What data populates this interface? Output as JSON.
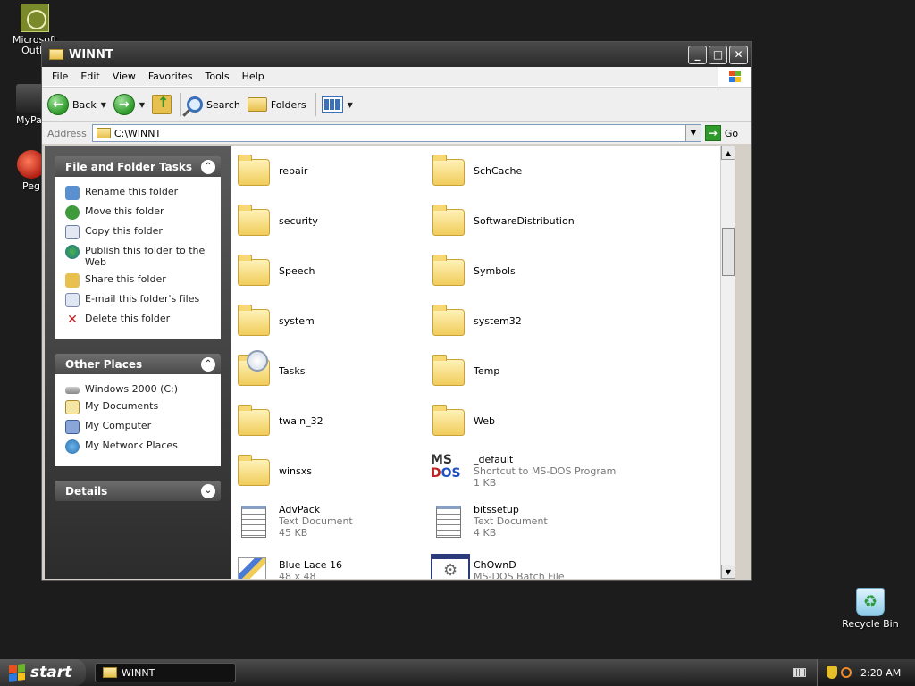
{
  "desktop": {
    "icons": [
      {
        "label": "Microsoft Outlo",
        "icon": "outlook-icon"
      },
      {
        "label": "MyPal",
        "icon": "palm-icon"
      },
      {
        "label": "Peg",
        "icon": "pegasus-icon"
      }
    ],
    "recycle_bin": "Recycle Bin"
  },
  "window": {
    "title": "WINNT",
    "controls": {
      "minimize": "_",
      "maximize": "□",
      "close": "✕"
    },
    "menu": [
      "File",
      "Edit",
      "View",
      "Favorites",
      "Tools",
      "Help"
    ],
    "toolbar": {
      "back": "Back",
      "search": "Search",
      "folders": "Folders"
    },
    "address": {
      "label": "Address",
      "value": "C:\\WINNT",
      "go": "Go"
    }
  },
  "taskpane": {
    "file_tasks": {
      "title": "File and Folder Tasks",
      "items": [
        {
          "label": "Rename this folder",
          "icon": "rename-icon"
        },
        {
          "label": "Move this folder",
          "icon": "move-icon"
        },
        {
          "label": "Copy this folder",
          "icon": "copy-icon"
        },
        {
          "label": "Publish this folder to the Web",
          "icon": "publish-icon"
        },
        {
          "label": "Share this folder",
          "icon": "share-icon"
        },
        {
          "label": "E-mail this folder's files",
          "icon": "email-icon"
        },
        {
          "label": "Delete this folder",
          "icon": "delete-icon"
        }
      ]
    },
    "other_places": {
      "title": "Other Places",
      "items": [
        {
          "label": "Windows 2000 (C:)",
          "icon": "drive-icon"
        },
        {
          "label": "My Documents",
          "icon": "my-documents-icon"
        },
        {
          "label": "My Computer",
          "icon": "my-computer-icon"
        },
        {
          "label": "My Network Places",
          "icon": "network-places-icon"
        }
      ]
    },
    "details": {
      "title": "Details"
    }
  },
  "files": [
    {
      "name": "repair",
      "type": "folder"
    },
    {
      "name": "SchCache",
      "type": "folder"
    },
    {
      "name": "security",
      "type": "folder"
    },
    {
      "name": "SoftwareDistribution",
      "type": "folder"
    },
    {
      "name": "Speech",
      "type": "folder"
    },
    {
      "name": "Symbols",
      "type": "folder"
    },
    {
      "name": "system",
      "type": "folder"
    },
    {
      "name": "system32",
      "type": "folder"
    },
    {
      "name": "Tasks",
      "type": "tasks-folder"
    },
    {
      "name": "Temp",
      "type": "folder"
    },
    {
      "name": "twain_32",
      "type": "folder"
    },
    {
      "name": "Web",
      "type": "folder"
    },
    {
      "name": "winsxs",
      "type": "folder"
    },
    {
      "name": "_default",
      "type": "msdos-shortcut",
      "desc": "Shortcut to MS-DOS Program",
      "size": "1 KB"
    },
    {
      "name": "AdvPack",
      "type": "text",
      "desc": "Text Document",
      "size": "45 KB"
    },
    {
      "name": "bitssetup",
      "type": "text",
      "desc": "Text Document",
      "size": "4 KB"
    },
    {
      "name": "Blue Lace 16",
      "type": "bitmap",
      "desc": "48 x 48",
      "size": ""
    },
    {
      "name": "ChOwnD",
      "type": "batch",
      "desc": "MS-DOS Batch File",
      "size": ""
    }
  ],
  "taskbar": {
    "start": "start",
    "task_button": "WINNT",
    "clock": "2:20 AM"
  }
}
